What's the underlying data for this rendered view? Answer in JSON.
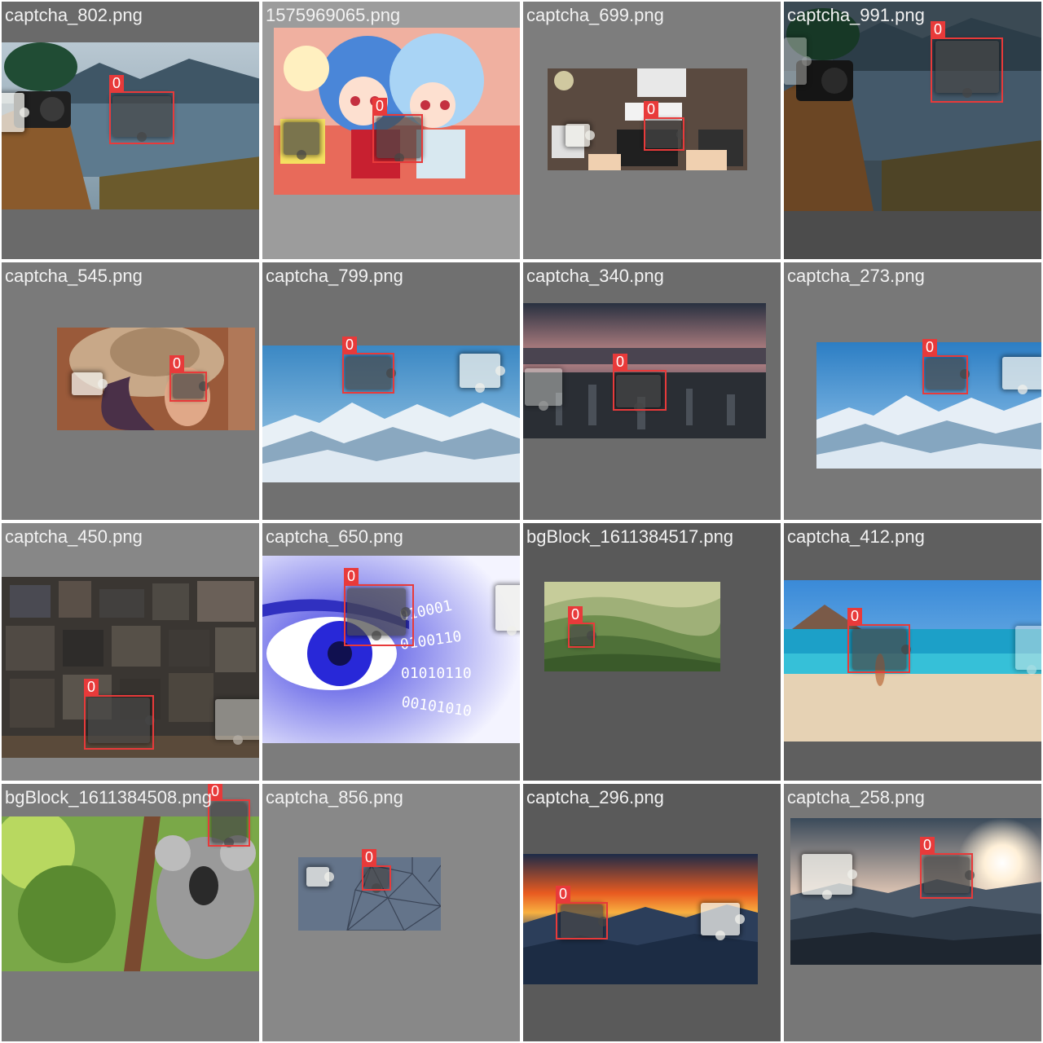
{
  "mosaic": {
    "class_label": "0",
    "box_color": "#e83a3a",
    "tiles": [
      {
        "filename": "captcha_802.png",
        "bg": "#6a6a6a",
        "scene": "photographer-lake"
      },
      {
        "filename": "1575969065.png",
        "bg": "#9c9c9c",
        "scene": "anime-illustration"
      },
      {
        "filename": "captcha_699.png",
        "bg": "#7d7d7d",
        "scene": "desk-workspace"
      },
      {
        "filename": "captcha_991.png",
        "bg": "#4c4c4c",
        "scene": "photographer-lake"
      },
      {
        "filename": "captcha_545.png",
        "bg": "#7a7a7a",
        "scene": "woman-hat"
      },
      {
        "filename": "captcha_799.png",
        "bg": "#707070",
        "scene": "snowy-mountains"
      },
      {
        "filename": "captcha_340.png",
        "bg": "#6c6c6c",
        "scene": "city-dusk"
      },
      {
        "filename": "captcha_273.png",
        "bg": "#787878",
        "scene": "snowy-mountains"
      },
      {
        "filename": "captcha_450.png",
        "bg": "#878787",
        "scene": "letterpress-blocks"
      },
      {
        "filename": "captcha_650.png",
        "bg": "#7c7c7c",
        "scene": "eye-binary"
      },
      {
        "filename": "bgBlock_1611384517.png",
        "bg": "#595959",
        "scene": "green-hills"
      },
      {
        "filename": "captcha_412.png",
        "bg": "#5f5f5f",
        "scene": "beach"
      },
      {
        "filename": "bgBlock_1611384508.png",
        "bg": "#7a7a7a",
        "scene": "koala"
      },
      {
        "filename": "captcha_856.png",
        "bg": "#888888",
        "scene": "polygon-network"
      },
      {
        "filename": "captcha_296.png",
        "bg": "#5a5a5a",
        "scene": "sunset-mountains"
      },
      {
        "filename": "captcha_258.png",
        "bg": "#777777",
        "scene": "sunburst-valley"
      }
    ]
  }
}
